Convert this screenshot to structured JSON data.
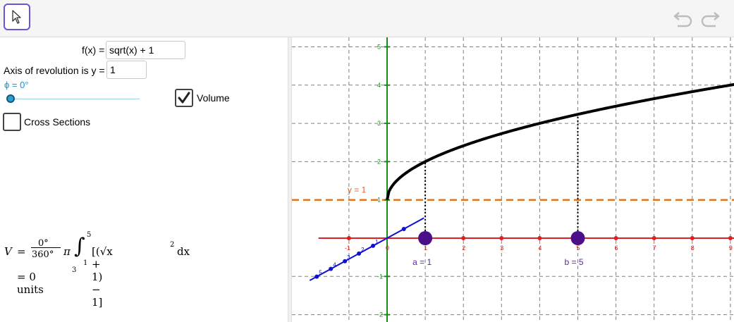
{
  "toolbar": {
    "move_tool": "arrow-pointer-icon",
    "undo": "undo-icon",
    "redo": "redo-icon"
  },
  "algebra": {
    "f_label": "f(x) =",
    "f_value": "sqrt(x) + 1",
    "axis_label": "Axis of revolution is y =",
    "axis_value": "1",
    "phi_label": "ϕ = 0°",
    "phi_value": 0,
    "volume_label": "Volume",
    "volume_checked": true,
    "cross_label": "Cross Sections",
    "cross_checked": false,
    "formula": {
      "V": "V",
      "eq": "=",
      "num": "0°",
      "den": "360°",
      "pi": "π",
      "upper": "5",
      "lower": "1",
      "integrand": "[(√x + 1) − 1]",
      "power": "2",
      "dx": "dx",
      "result_eq": "= 0 units",
      "result_exp": "3"
    }
  },
  "graph": {
    "x_ticks": [
      "-1",
      "0",
      "1",
      "2",
      "3",
      "4",
      "5",
      "6",
      "7",
      "8",
      "9"
    ],
    "y_ticks": [
      "-2",
      "-1",
      "1",
      "2",
      "3",
      "4",
      "5"
    ],
    "z_ticks": [
      "1",
      "2",
      "3",
      "4",
      "5"
    ],
    "xlim": [
      -1.8,
      9.2
    ],
    "ylim": [
      -2.2,
      5.2
    ],
    "y_line_label": "y = 1",
    "a_label": "a = 1",
    "b_label": "b = 5",
    "a": 1,
    "b": 5,
    "axis_y": 1,
    "colors": {
      "curve": "#000000",
      "x_axis": "#e02020",
      "y_axis": "#1a8a1a",
      "dashed": "#e8741c",
      "points": "#4b0f8a",
      "z_axis": "#1010d0",
      "grid": "#808080"
    }
  }
}
